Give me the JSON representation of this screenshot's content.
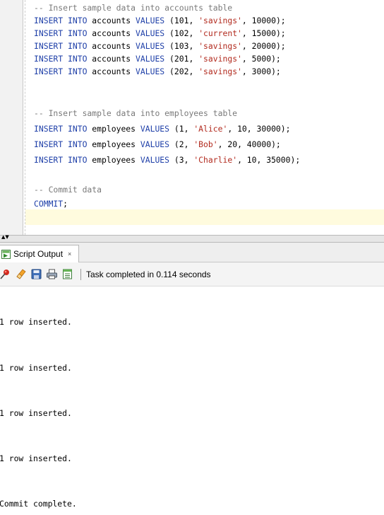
{
  "editor": {
    "lines": [
      [
        {
          "t": "-- Insert sample data into accounts table",
          "c": "cm"
        }
      ],
      [
        {
          "t": "INSERT INTO",
          "c": "kw"
        },
        {
          "t": " accounts ",
          "c": ""
        },
        {
          "t": "VALUES",
          "c": "kw"
        },
        {
          "t": " (",
          "c": ""
        },
        {
          "t": "101",
          "c": "num"
        },
        {
          "t": ", ",
          "c": ""
        },
        {
          "t": "'savings'",
          "c": "str"
        },
        {
          "t": ", ",
          "c": ""
        },
        {
          "t": "10000",
          "c": "num"
        },
        {
          "t": ");",
          "c": ""
        }
      ],
      [
        {
          "t": "INSERT INTO",
          "c": "kw"
        },
        {
          "t": " accounts ",
          "c": ""
        },
        {
          "t": "VALUES",
          "c": "kw"
        },
        {
          "t": " (",
          "c": ""
        },
        {
          "t": "102",
          "c": "num"
        },
        {
          "t": ", ",
          "c": ""
        },
        {
          "t": "'current'",
          "c": "str"
        },
        {
          "t": ", ",
          "c": ""
        },
        {
          "t": "15000",
          "c": "num"
        },
        {
          "t": ");",
          "c": ""
        }
      ],
      [
        {
          "t": "INSERT INTO",
          "c": "kw"
        },
        {
          "t": " accounts ",
          "c": ""
        },
        {
          "t": "VALUES",
          "c": "kw"
        },
        {
          "t": " (",
          "c": ""
        },
        {
          "t": "103",
          "c": "num"
        },
        {
          "t": ", ",
          "c": ""
        },
        {
          "t": "'savings'",
          "c": "str"
        },
        {
          "t": ", ",
          "c": ""
        },
        {
          "t": "20000",
          "c": "num"
        },
        {
          "t": ");",
          "c": ""
        }
      ],
      [
        {
          "t": "INSERT INTO",
          "c": "kw"
        },
        {
          "t": " accounts ",
          "c": ""
        },
        {
          "t": "VALUES",
          "c": "kw"
        },
        {
          "t": " (",
          "c": ""
        },
        {
          "t": "201",
          "c": "num"
        },
        {
          "t": ", ",
          "c": ""
        },
        {
          "t": "'savings'",
          "c": "str"
        },
        {
          "t": ", ",
          "c": ""
        },
        {
          "t": "5000",
          "c": "num"
        },
        {
          "t": ");",
          "c": ""
        }
      ],
      [
        {
          "t": "INSERT INTO",
          "c": "kw"
        },
        {
          "t": " accounts ",
          "c": ""
        },
        {
          "t": "VALUES",
          "c": "kw"
        },
        {
          "t": " (",
          "c": ""
        },
        {
          "t": "202",
          "c": "num"
        },
        {
          "t": ", ",
          "c": ""
        },
        {
          "t": "'savings'",
          "c": "str"
        },
        {
          "t": ", ",
          "c": ""
        },
        {
          "t": "3000",
          "c": "num"
        },
        {
          "t": ");",
          "c": ""
        }
      ],
      [],
      [
        {
          "t": "-- Insert sample data into employees table",
          "c": "cm"
        }
      ],
      [
        {
          "t": "INSERT INTO",
          "c": "kw"
        },
        {
          "t": " employees ",
          "c": ""
        },
        {
          "t": "VALUES",
          "c": "kw"
        },
        {
          "t": " (",
          "c": ""
        },
        {
          "t": "1",
          "c": "num"
        },
        {
          "t": ", ",
          "c": ""
        },
        {
          "t": "'Alice'",
          "c": "str"
        },
        {
          "t": ", ",
          "c": ""
        },
        {
          "t": "10",
          "c": "num"
        },
        {
          "t": ", ",
          "c": ""
        },
        {
          "t": "30000",
          "c": "num"
        },
        {
          "t": ");",
          "c": ""
        }
      ],
      [
        {
          "t": "INSERT INTO",
          "c": "kw"
        },
        {
          "t": " employees ",
          "c": ""
        },
        {
          "t": "VALUES",
          "c": "kw"
        },
        {
          "t": " (",
          "c": ""
        },
        {
          "t": "2",
          "c": "num"
        },
        {
          "t": ", ",
          "c": ""
        },
        {
          "t": "'Bob'",
          "c": "str"
        },
        {
          "t": ", ",
          "c": ""
        },
        {
          "t": "20",
          "c": "num"
        },
        {
          "t": ", ",
          "c": ""
        },
        {
          "t": "40000",
          "c": "num"
        },
        {
          "t": ");",
          "c": ""
        }
      ],
      [
        {
          "t": "INSERT INTO",
          "c": "kw"
        },
        {
          "t": " employees ",
          "c": ""
        },
        {
          "t": "VALUES",
          "c": "kw"
        },
        {
          "t": " (",
          "c": ""
        },
        {
          "t": "3",
          "c": "num"
        },
        {
          "t": ", ",
          "c": ""
        },
        {
          "t": "'Charlie'",
          "c": "str"
        },
        {
          "t": ", ",
          "c": ""
        },
        {
          "t": "10",
          "c": "num"
        },
        {
          "t": ", ",
          "c": ""
        },
        {
          "t": "35000",
          "c": "num"
        },
        {
          "t": ");",
          "c": ""
        }
      ],
      [],
      [
        {
          "t": "-- Commit data",
          "c": "cm"
        }
      ],
      [
        {
          "t": "COMMIT",
          "c": "kw"
        },
        {
          "t": ";",
          "c": ""
        }
      ]
    ]
  },
  "output_panel": {
    "tab_label": "Script Output",
    "tab_close": "×",
    "status": "Task completed in 0.114 seconds",
    "toolbar_icons": [
      "pin-icon",
      "eraser-icon",
      "save-icon",
      "print-icon",
      "open-file-icon"
    ]
  },
  "output_lines": [
    "1 row inserted.",
    "1 row inserted.",
    "1 row inserted.",
    "1 row inserted.",
    "Commit complete."
  ],
  "colors": {
    "keyword": "#1e3fa8",
    "comment": "#7a7a7a",
    "string": "#b22a1e",
    "current_line": "#fffbde"
  }
}
